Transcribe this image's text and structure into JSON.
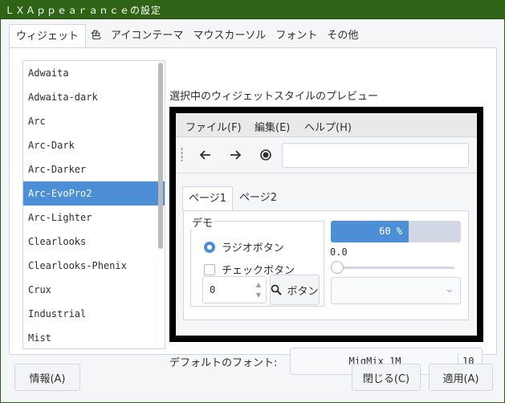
{
  "window": {
    "title": "ＬＸＡｐｐｅａｒａｎｃｅの設定"
  },
  "tabs": [
    {
      "label": "ウィジェット"
    },
    {
      "label": "色"
    },
    {
      "label": "アイコンテーマ"
    },
    {
      "label": "マウスカーソル"
    },
    {
      "label": "フォント"
    },
    {
      "label": "その他"
    }
  ],
  "theme_list": {
    "items": [
      "Adwaita",
      "Adwaita-dark",
      "Arc",
      "Arc-Dark",
      "Arc-Darker",
      "Arc-EvoPro2",
      "Arc-Lighter",
      "Clearlooks",
      "Clearlooks-Phenix",
      "Crux",
      "Industrial",
      "Mist"
    ],
    "selected": "Arc-EvoPro2"
  },
  "preview": {
    "label": "選択中のウィジェットスタイルのプレビュー",
    "menu": [
      "ファイル(F)",
      "編集(E)",
      "ヘルプ(H)"
    ],
    "notebook_tabs": [
      "ページ1",
      "ページ2"
    ],
    "frame_title": "デモ",
    "radio_label": "ラジオボタン",
    "check_label": "チェックボタン",
    "spin_value": "0",
    "button_label": "ボタン",
    "progress_text": "60 %",
    "progress_value": 0.6,
    "scale_value": "0.0",
    "entry_value": ""
  },
  "default_font": {
    "label": "デフォルトのフォント:",
    "name": "MigMix 1M",
    "size": "10"
  },
  "footer": {
    "about_label": "情報(A)",
    "close_label": "閉じる(C)",
    "apply_label": "適用(A)"
  },
  "colors": {
    "titlebar": "#2f6416",
    "accent": "#4d8fd6"
  }
}
